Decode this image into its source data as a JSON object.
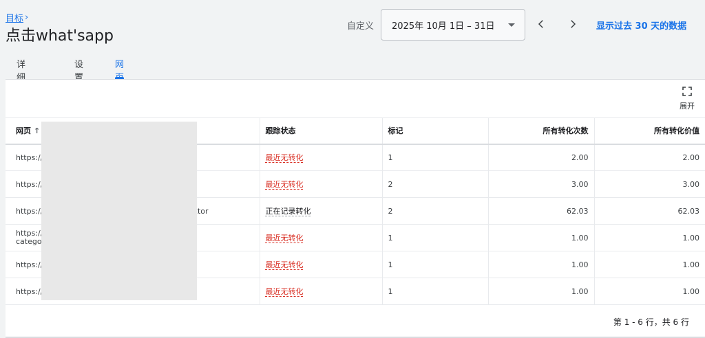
{
  "header": {
    "breadcrumb": "目标",
    "title": "点击what'sapp"
  },
  "date_range": {
    "label": "自定义",
    "value": "2025年 10月 1日 – 31日",
    "show_30_days": "显示过去 30 天的数据"
  },
  "tabs": [
    {
      "label": "详细信息",
      "active": false
    },
    {
      "label": "设置",
      "active": false
    },
    {
      "label": "网页",
      "active": true
    }
  ],
  "toolbar": {
    "expand_label": "展开"
  },
  "table": {
    "columns": [
      "网页",
      "跟踪状态",
      "标记",
      "所有转化次数",
      "所有转化价值"
    ],
    "sort_indicator": "↑",
    "rows": [
      {
        "url": "https://",
        "status": "最近无转化",
        "status_type": "warn",
        "mark": "1",
        "conversions": "2.00",
        "value": "2.00"
      },
      {
        "url": "https://",
        "status": "最近无转化",
        "status_type": "warn",
        "mark": "2",
        "conversions": "3.00",
        "value": "3.00"
      },
      {
        "url": "https://",
        "url_suffix": "ctor",
        "status": "正在记录转化",
        "status_type": "ok",
        "mark": "2",
        "conversions": "62.03",
        "value": "62.03"
      },
      {
        "url": "https://",
        "url_line2": "categor",
        "status": "最近无转化",
        "status_type": "warn",
        "mark": "1",
        "conversions": "1.00",
        "value": "1.00"
      },
      {
        "url": "https://",
        "status": "最近无转化",
        "status_type": "warn",
        "mark": "1",
        "conversions": "1.00",
        "value": "1.00"
      },
      {
        "url": "https://",
        "status": "最近无转化",
        "status_type": "warn",
        "mark": "1",
        "conversions": "1.00",
        "value": "1.00"
      }
    ]
  },
  "pagination": {
    "text": "第 1 - 6 行，共 6 行"
  },
  "colors": {
    "accent": "#1a73e8",
    "warn": "#d93025",
    "background": "#f1f3f4"
  },
  "icons": [
    "chevron-right-icon",
    "caret-down-icon",
    "chevron-left-icon",
    "chevron-right-icon",
    "expand-icon",
    "sort-up-icon"
  ]
}
